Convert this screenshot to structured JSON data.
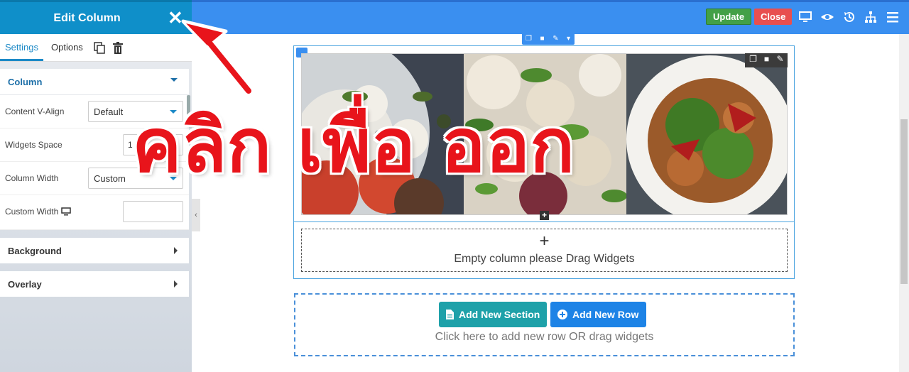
{
  "panel": {
    "title": "Edit Column",
    "close_icon": "close-icon",
    "tabs": [
      {
        "label": "Settings",
        "active": true
      },
      {
        "label": "Options"
      }
    ],
    "sections": {
      "column": {
        "label": "Column",
        "fields": {
          "content_valign": {
            "label": "Content V-Align",
            "value": "Default"
          },
          "widgets_space": {
            "label": "Widgets Space",
            "value": "1"
          },
          "column_width": {
            "label": "Column Width",
            "value": "Custom"
          },
          "custom_width": {
            "label": "Custom Width",
            "value": ""
          }
        }
      },
      "background": {
        "label": "Background"
      },
      "overlay": {
        "label": "Overlay"
      }
    }
  },
  "toolbar": {
    "update_label": "Update",
    "close_label": "Close",
    "icons": [
      "desktop-icon",
      "eye-icon",
      "history-icon",
      "sitemap-icon",
      "menu-icon"
    ]
  },
  "canvas": {
    "empty_column": {
      "plus": "+",
      "message": "Empty column please Drag Widgets"
    },
    "add_section_label": "Add New Section",
    "add_row_label": "Add New Row",
    "hint": "Click here to add new row OR drag widgets"
  },
  "annotation": {
    "text": "คลิก เพื่อ ออก",
    "color": "#e8141b"
  },
  "colors": {
    "topbar": "#3a8ff0",
    "panel_header": "#0f8fc9",
    "update": "#43a047",
    "close": "#e84f4f",
    "section_btn": "#1ea1a9",
    "row_btn": "#1d83e6"
  }
}
